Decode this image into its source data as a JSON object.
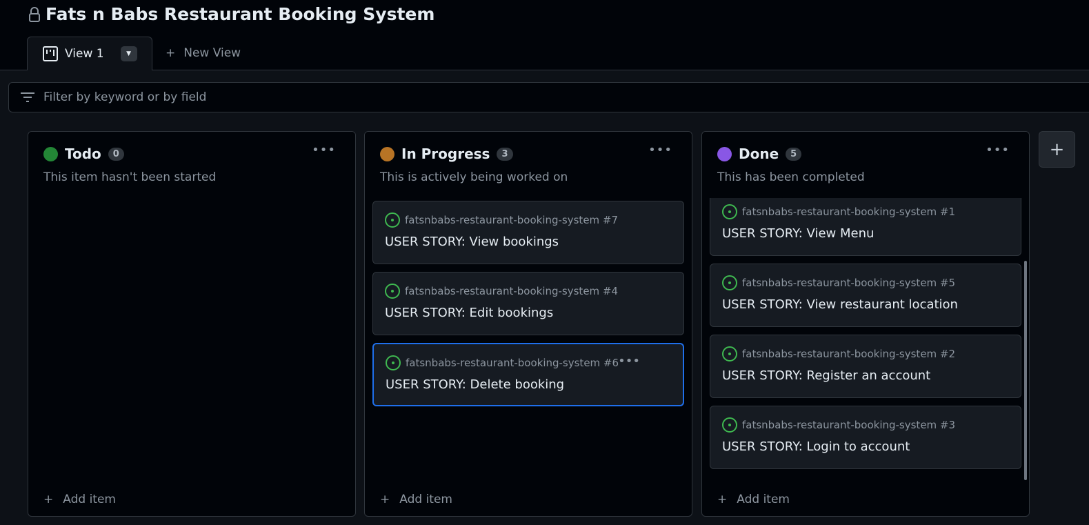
{
  "project": {
    "title": "Fats n Babs Restaurant Booking System"
  },
  "tabs": [
    {
      "label": "View 1"
    }
  ],
  "new_view": "New View",
  "filter": {
    "placeholder": "Filter by keyword or by field"
  },
  "columns": [
    {
      "name": "Todo",
      "count": "0",
      "color": "#238636",
      "description": "This item hasn't been started",
      "add": "Add item",
      "cards": []
    },
    {
      "name": "In Progress",
      "count": "3",
      "color": "#b87425",
      "description": "This is actively being worked on",
      "add": "Add item",
      "cards": [
        {
          "repo": "fatsnbabs-restaurant-booking-system #7",
          "title": "USER STORY: View bookings"
        },
        {
          "repo": "fatsnbabs-restaurant-booking-system #4",
          "title": "USER STORY: Edit bookings"
        },
        {
          "repo": "fatsnbabs-restaurant-booking-system #6",
          "title": "USER STORY: Delete booking",
          "selected": true
        }
      ]
    },
    {
      "name": "Done",
      "count": "5",
      "color": "#8957e5",
      "description": "This has been completed",
      "add": "Add item",
      "cards": [
        {
          "repo": "fatsnbabs-restaurant-booking-system #1",
          "title": "USER STORY: View Menu"
        },
        {
          "repo": "fatsnbabs-restaurant-booking-system #5",
          "title": "USER STORY: View restaurant location"
        },
        {
          "repo": "fatsnbabs-restaurant-booking-system #2",
          "title": "USER STORY: Register an account"
        },
        {
          "repo": "fatsnbabs-restaurant-booking-system #3",
          "title": "USER STORY: Login to account"
        }
      ]
    }
  ]
}
